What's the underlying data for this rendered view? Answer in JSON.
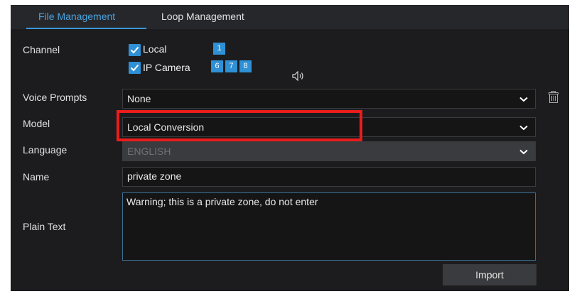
{
  "tabs": [
    {
      "label": "File Management",
      "active": true
    },
    {
      "label": "Loop Management",
      "active": false
    }
  ],
  "channel": {
    "label": "Channel",
    "local": {
      "label": "Local",
      "checked": true,
      "channels": [
        "1"
      ]
    },
    "ip_camera": {
      "label": "IP Camera",
      "checked": true,
      "channels": [
        "6",
        "7",
        "8"
      ]
    }
  },
  "voice_prompts": {
    "label": "Voice Prompts",
    "value": "None"
  },
  "model": {
    "label": "Model",
    "value": "Local Conversion"
  },
  "language": {
    "label": "Language",
    "value": "ENGLISH",
    "disabled": true
  },
  "name": {
    "label": "Name",
    "value": "private zone"
  },
  "plain_text": {
    "label": "Plain Text",
    "value": "Warning; this is a private zone, do not enter"
  },
  "import_button": {
    "label": "Import"
  },
  "colors": {
    "accent": "#2f90d6",
    "active_tab": "#4aa3df",
    "highlight": "#ea1c1c",
    "panel_bg": "#1c1c1e"
  },
  "icons": [
    "check-icon",
    "speaker-icon",
    "chevron-down-icon",
    "trash-icon"
  ]
}
